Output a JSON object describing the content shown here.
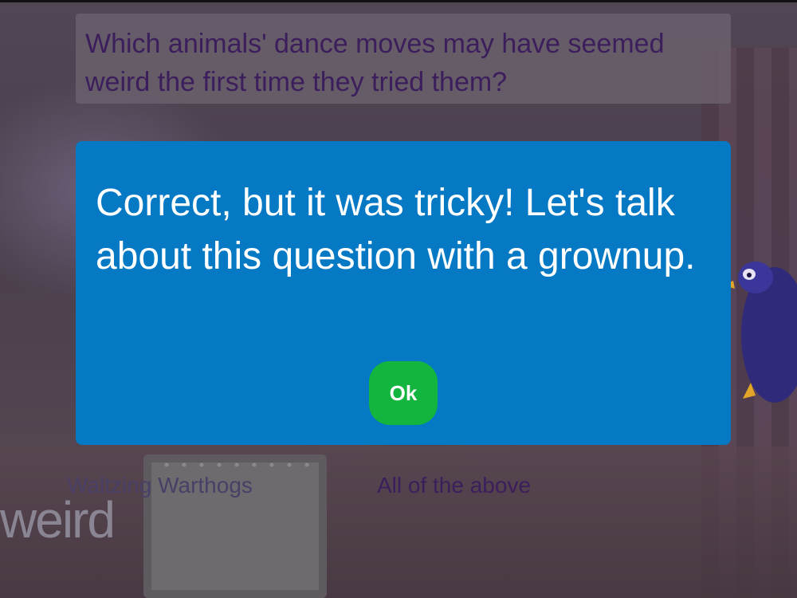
{
  "question": {
    "text": "Which animals' dance moves may have seemed weird the first time they tried them?"
  },
  "answers": [
    {
      "label": "Waltzing Warthogs"
    },
    {
      "label": "All of the above"
    }
  ],
  "sign": {
    "text": "weird"
  },
  "dialog": {
    "message": "Correct, but it was tricky! Let's talk about this question with a grownup.",
    "ok_label": "Ok"
  },
  "colors": {
    "dialog_bg": "#0679c4",
    "ok_button": "#14b53e",
    "question_text": "#3c1e5c"
  }
}
